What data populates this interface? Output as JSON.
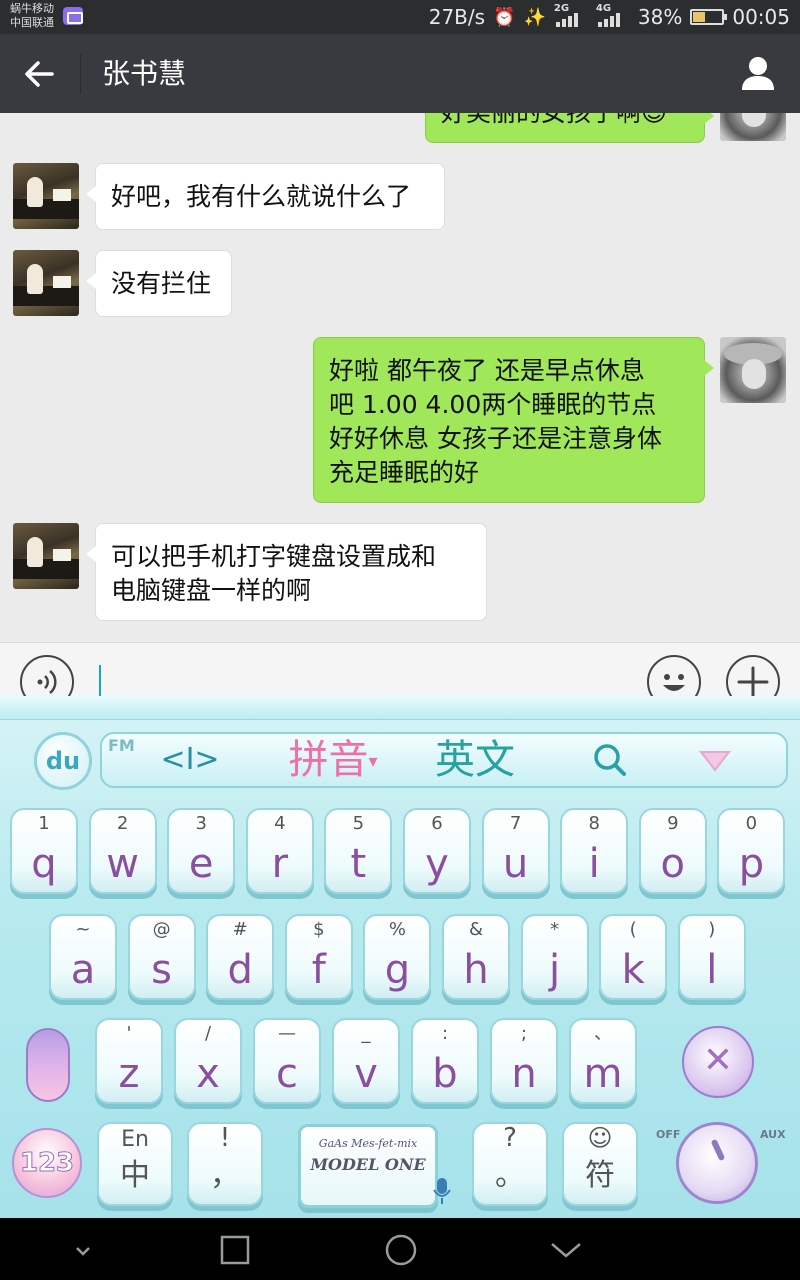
{
  "status_bar": {
    "carrier_line1": "蜗牛移动",
    "carrier_line2": "中国联通",
    "net_speed": "27B/s",
    "signal1_type": "2G",
    "signal2_type": "4G",
    "battery_percent": "38%",
    "battery_level": 0.38,
    "time": "00:05"
  },
  "header": {
    "title": "张书慧"
  },
  "chat": {
    "messages": [
      {
        "side": "out",
        "text": "好美丽的女孩子啊😊"
      },
      {
        "side": "in",
        "text": "好吧，我有什么就说什么了"
      },
      {
        "side": "in",
        "text": "没有拦住"
      },
      {
        "side": "out",
        "lines": [
          "好啦  都午夜了  还是早点休息",
          "吧   1.00   4.00两个睡眠的节点",
          "好好休息  女孩子还是注意身体",
          "充足睡眠的好"
        ]
      },
      {
        "side": "in",
        "lines": [
          "可以把手机打字键盘设置成和",
          "电脑键盘一样的啊"
        ]
      }
    ]
  },
  "keyboard": {
    "du_label": "du",
    "fm_label": "FM",
    "toolbar": {
      "cursor_glyph": "<I>",
      "pinyin": "拼音",
      "english": "英文",
      "search_glyph": "⌕",
      "collapse_glyph": "▽"
    },
    "row1": [
      {
        "sub": "1",
        "main": "q"
      },
      {
        "sub": "2",
        "main": "w"
      },
      {
        "sub": "3",
        "main": "e"
      },
      {
        "sub": "4",
        "main": "r"
      },
      {
        "sub": "5",
        "main": "t"
      },
      {
        "sub": "6",
        "main": "y"
      },
      {
        "sub": "7",
        "main": "u"
      },
      {
        "sub": "8",
        "main": "i"
      },
      {
        "sub": "9",
        "main": "o"
      },
      {
        "sub": "0",
        "main": "p"
      }
    ],
    "row2": [
      {
        "sub": "~",
        "main": "a"
      },
      {
        "sub": "@",
        "main": "s"
      },
      {
        "sub": "#",
        "main": "d"
      },
      {
        "sub": "$",
        "main": "f"
      },
      {
        "sub": "%",
        "main": "g"
      },
      {
        "sub": "&",
        "main": "h"
      },
      {
        "sub": "*",
        "main": "j"
      },
      {
        "sub": "(",
        "main": "k"
      },
      {
        "sub": ")",
        "main": "l"
      }
    ],
    "row3": [
      {
        "sub": "'",
        "main": "z"
      },
      {
        "sub": "/",
        "main": "x"
      },
      {
        "sub": "—",
        "main": "c"
      },
      {
        "sub": "_",
        "main": "v"
      },
      {
        "sub": ":",
        "main": "b"
      },
      {
        "sub": ";",
        "main": "n"
      },
      {
        "sub": "、",
        "main": "m"
      }
    ],
    "num_key": "123",
    "lang_key": {
      "sub": "En",
      "main": "中"
    },
    "punct_key": {
      "sub": "!",
      "main": "，"
    },
    "space_key": {
      "line1": "GaAs Mes-fet-mix",
      "line2": "MODEL ONE"
    },
    "question_key": {
      "sub": "?",
      "main": "。"
    },
    "symbol_key": {
      "sub": "☺",
      "main": "符"
    },
    "delete_glyph": "✕",
    "knob_off": "OFF",
    "knob_aux": "AUX"
  }
}
